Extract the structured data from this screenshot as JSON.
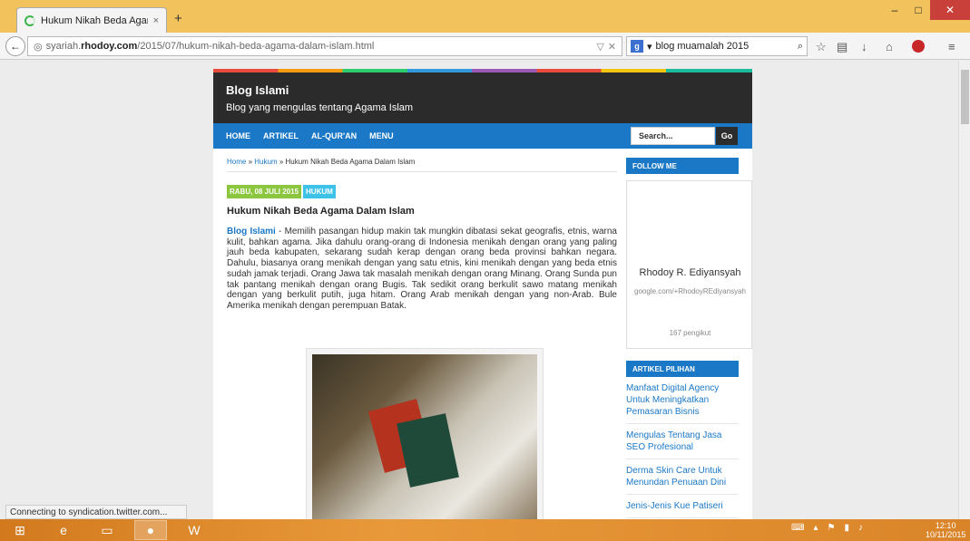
{
  "browser": {
    "tab_title": "Hukum Nikah Beda Agam...",
    "tab_close": "×",
    "new_tab": "+",
    "url_prefix": "syariah.",
    "url_domain": "rhodoy.com",
    "url_path": "/2015/07/hukum-nikah-beda-agama-dalam-islam.html",
    "search_query": "blog muamalah 2015",
    "window_min": "–",
    "window_max": "□",
    "window_close": "✕",
    "status_text": "Connecting to syndication.twitter.com..."
  },
  "blog": {
    "title": "Blog Islami",
    "description": "Blog yang mengulas tentang Agama Islam",
    "menu": [
      "HOME",
      "ARTIKEL",
      "AL-QUR'AN",
      "MENU"
    ],
    "search_placeholder": "Search...",
    "search_button": "Go"
  },
  "post": {
    "breadcrumb_home": "Home",
    "breadcrumb_sep": " » ",
    "breadcrumb_cat": "Hukum",
    "breadcrumb_current": "Hukum Nikah Beda Agama Dalam Islam",
    "date": "RABU, 08 JULI 2015",
    "category": "HUKUM",
    "title": "Hukum Nikah Beda Agama Dalam Islam",
    "lead": "Blog Islami",
    "body": " - Memilih pasangan hidup makin tak mungkin dibatasi sekat geografis, etnis, warna kulit, bahkan agama. Jika dahulu orang-orang di Indonesia menikah dengan orang yang paling jauh beda kabupaten, sekarang sudah kerap dengan orang beda provinsi bahkan negara. Dahulu, biasanya orang menikah dengan yang satu etnis, kini menikah dengan yang beda etnis sudah jamak terjadi. Orang Jawa tak masalah menikah dengan orang Minang. Orang Sunda pun tak pantang menikah dengan orang Bugis. Tak sedikit orang berkulit sawo matang menikah dengan yang berkulit putih, juga hitam. Orang Arab menikah dengan yang non-Arab. Bule Amerika menikah dengan perempuan Batak."
  },
  "sidebar": {
    "follow_title": "FOLLOW ME",
    "follow_name": "Rhodoy R. Ediyansyah",
    "follow_link": "google.com/+RhodoyREdiyansyah",
    "follow_count": "167 pengikut",
    "articles_title": "ARTIKEL PILIHAN",
    "articles": [
      "Manfaat Digital Agency Untuk Meningkatkan Pemasaran Bisnis",
      "Mengulas Tentang Jasa SEO Profesional",
      "Derma Skin Care Untuk Menundan Penuaan Dini",
      "Jenis-Jenis Kue Patiseri"
    ]
  },
  "taskbar": {
    "clock_time": "12:10",
    "clock_date": "10/11/2015"
  },
  "colors": {
    "menu_blue": "#1b78c7",
    "header_dark": "#2b2b2b",
    "date_green": "#8cc63f",
    "category_cyan": "#3fc2e8",
    "firefox_title": "#f2c25c"
  }
}
